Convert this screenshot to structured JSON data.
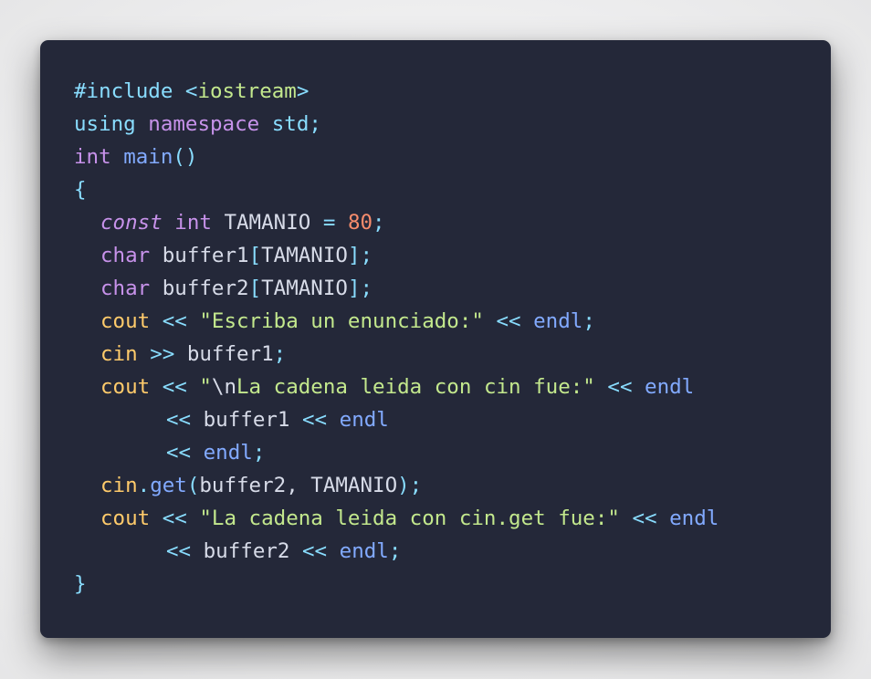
{
  "code_lines": [
    [
      {
        "t": "#include",
        "c": "t-pre"
      },
      {
        "t": " ",
        "c": ""
      },
      {
        "t": "<iostream>",
        "c": "t-lib-mix"
      }
    ],
    [
      {
        "t": "using",
        "c": "t-ns"
      },
      {
        "t": " ",
        "c": ""
      },
      {
        "t": "namespace",
        "c": "t-kw"
      },
      {
        "t": " ",
        "c": ""
      },
      {
        "t": "std",
        "c": "t-ns"
      },
      {
        "t": ";",
        "c": "t-punc"
      }
    ],
    [
      {
        "t": "int",
        "c": "t-kw"
      },
      {
        "t": " ",
        "c": ""
      },
      {
        "t": "main",
        "c": "t-fn"
      },
      {
        "t": "()",
        "c": "t-punc"
      }
    ],
    [
      {
        "t": "{",
        "c": "t-punc"
      }
    ],
    [
      {
        "t": "const",
        "c": "t-kw-i"
      },
      {
        "t": " ",
        "c": ""
      },
      {
        "t": "int",
        "c": "t-kw"
      },
      {
        "t": " TAMANIO ",
        "c": "t-id"
      },
      {
        "t": "=",
        "c": "t-op"
      },
      {
        "t": " ",
        "c": ""
      },
      {
        "t": "80",
        "c": "t-num"
      },
      {
        "t": ";",
        "c": "t-punc"
      }
    ],
    [
      {
        "t": "char",
        "c": "t-kw"
      },
      {
        "t": " buffer1",
        "c": "t-id"
      },
      {
        "t": "[",
        "c": "t-punc"
      },
      {
        "t": "TAMANIO",
        "c": "t-id"
      },
      {
        "t": "];",
        "c": "t-punc"
      }
    ],
    [
      {
        "t": "char",
        "c": "t-kw"
      },
      {
        "t": " buffer2",
        "c": "t-id"
      },
      {
        "t": "[",
        "c": "t-punc"
      },
      {
        "t": "TAMANIO",
        "c": "t-id"
      },
      {
        "t": "];",
        "c": "t-punc"
      }
    ],
    [
      {
        "t": "cout",
        "c": "t-var"
      },
      {
        "t": " ",
        "c": ""
      },
      {
        "t": "<<",
        "c": "t-op"
      },
      {
        "t": " ",
        "c": ""
      },
      {
        "t": "\"Escriba un enunciado:\"",
        "c": "t-str"
      },
      {
        "t": " ",
        "c": ""
      },
      {
        "t": "<<",
        "c": "t-op"
      },
      {
        "t": " ",
        "c": ""
      },
      {
        "t": "endl",
        "c": "t-fn"
      },
      {
        "t": ";",
        "c": "t-punc"
      }
    ],
    [
      {
        "t": "cin",
        "c": "t-var"
      },
      {
        "t": " ",
        "c": ""
      },
      {
        "t": ">>",
        "c": "t-op"
      },
      {
        "t": " buffer1",
        "c": "t-id"
      },
      {
        "t": ";",
        "c": "t-punc"
      }
    ],
    [
      {
        "t": "cout",
        "c": "t-var"
      },
      {
        "t": " ",
        "c": ""
      },
      {
        "t": "<<",
        "c": "t-op"
      },
      {
        "t": " ",
        "c": ""
      },
      {
        "t": "\"",
        "c": "t-str"
      },
      {
        "t": "\\n",
        "c": "t-id"
      },
      {
        "t": "La cadena leida con cin fue:\"",
        "c": "t-str"
      },
      {
        "t": " ",
        "c": ""
      },
      {
        "t": "<<",
        "c": "t-op"
      },
      {
        "t": " ",
        "c": ""
      },
      {
        "t": "endl",
        "c": "t-fn"
      }
    ],
    [
      {
        "t": "<<",
        "c": "t-op"
      },
      {
        "t": " buffer1 ",
        "c": "t-id"
      },
      {
        "t": "<<",
        "c": "t-op"
      },
      {
        "t": " ",
        "c": ""
      },
      {
        "t": "endl",
        "c": "t-fn"
      }
    ],
    [
      {
        "t": "<<",
        "c": "t-op"
      },
      {
        "t": " ",
        "c": ""
      },
      {
        "t": "endl",
        "c": "t-fn"
      },
      {
        "t": ";",
        "c": "t-punc"
      }
    ],
    [
      {
        "t": "cin",
        "c": "t-var"
      },
      {
        "t": ".",
        "c": "t-punc"
      },
      {
        "t": "get",
        "c": "t-fn"
      },
      {
        "t": "(",
        "c": "t-punc"
      },
      {
        "t": "buffer2, TAMANIO",
        "c": "t-id"
      },
      {
        "t": ");",
        "c": "t-punc"
      }
    ],
    [
      {
        "t": "cout",
        "c": "t-var"
      },
      {
        "t": " ",
        "c": ""
      },
      {
        "t": "<<",
        "c": "t-op"
      },
      {
        "t": " ",
        "c": ""
      },
      {
        "t": "\"La cadena leida con cin.get fue:\"",
        "c": "t-str"
      },
      {
        "t": " ",
        "c": ""
      },
      {
        "t": "<<",
        "c": "t-op"
      },
      {
        "t": " ",
        "c": ""
      },
      {
        "t": "endl",
        "c": "t-fn"
      }
    ],
    [
      {
        "t": "<<",
        "c": "t-op"
      },
      {
        "t": " buffer2 ",
        "c": "t-id"
      },
      {
        "t": "<<",
        "c": "t-op"
      },
      {
        "t": " ",
        "c": ""
      },
      {
        "t": "endl",
        "c": "t-fn"
      },
      {
        "t": ";",
        "c": "t-punc"
      }
    ],
    [
      {
        "t": "}",
        "c": "t-punc"
      }
    ]
  ],
  "line_indents": [
    0,
    0,
    0,
    0,
    2,
    2,
    2,
    2,
    2,
    2,
    6,
    6,
    2,
    2,
    6,
    0
  ],
  "colors": {
    "background": "#242839",
    "keyword": "#c792ea",
    "function": "#82aaff",
    "namespace": "#89ddff",
    "identifier": "#d7dbe8",
    "variable": "#ffcb6b",
    "string": "#c3e88d",
    "number": "#f78c6c"
  }
}
